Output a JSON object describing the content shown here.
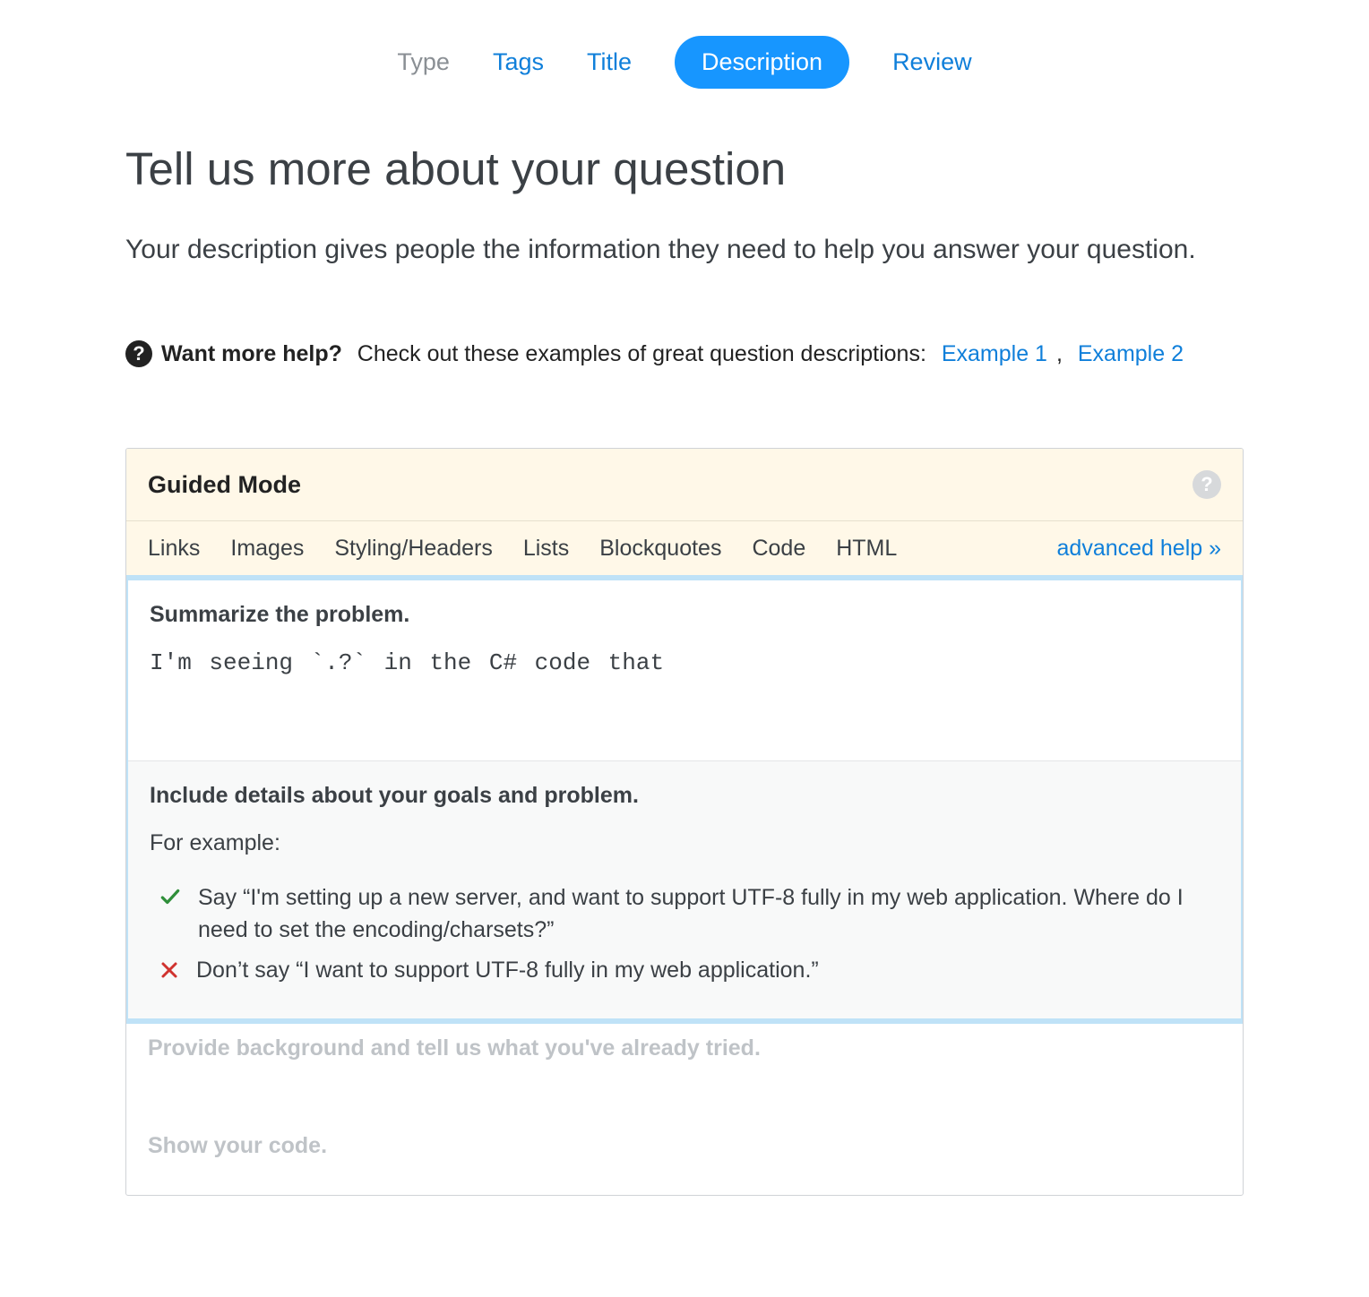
{
  "nav": {
    "type": "Type",
    "tags": "Tags",
    "title": "Title",
    "description": "Description",
    "review": "Review"
  },
  "header": {
    "title": "Tell us more about your question",
    "subtitle": "Your description gives people the information they need to help you answer your question."
  },
  "help_line": {
    "strong": "Want more help?",
    "text": " Check out these examples of great question descriptions: ",
    "example1": "Example 1",
    "separator": ", ",
    "example2": "Example 2"
  },
  "editor": {
    "guided_label": "Guided Mode",
    "toolbar": {
      "links": "Links",
      "images": "Images",
      "styling": "Styling/Headers",
      "lists": "Lists",
      "blockquotes": "Blockquotes",
      "code": "Code",
      "html": "HTML",
      "advanced_help": "advanced help »"
    },
    "summary": {
      "label": "Summarize the problem.",
      "value": "I'm seeing `.?` in the C# code that"
    },
    "details": {
      "label": "Include details about your goals and problem.",
      "for_example": "For example:",
      "good": "Say “I'm setting up a new server, and want to support UTF-8 fully in my web application. Where do I need to set the encoding/charsets?”",
      "bad": "Don’t say “I want to support UTF-8 fully in my web application.”"
    },
    "placeholder_background": "Provide background and tell us what you've already tried.",
    "placeholder_code": "Show your code."
  }
}
